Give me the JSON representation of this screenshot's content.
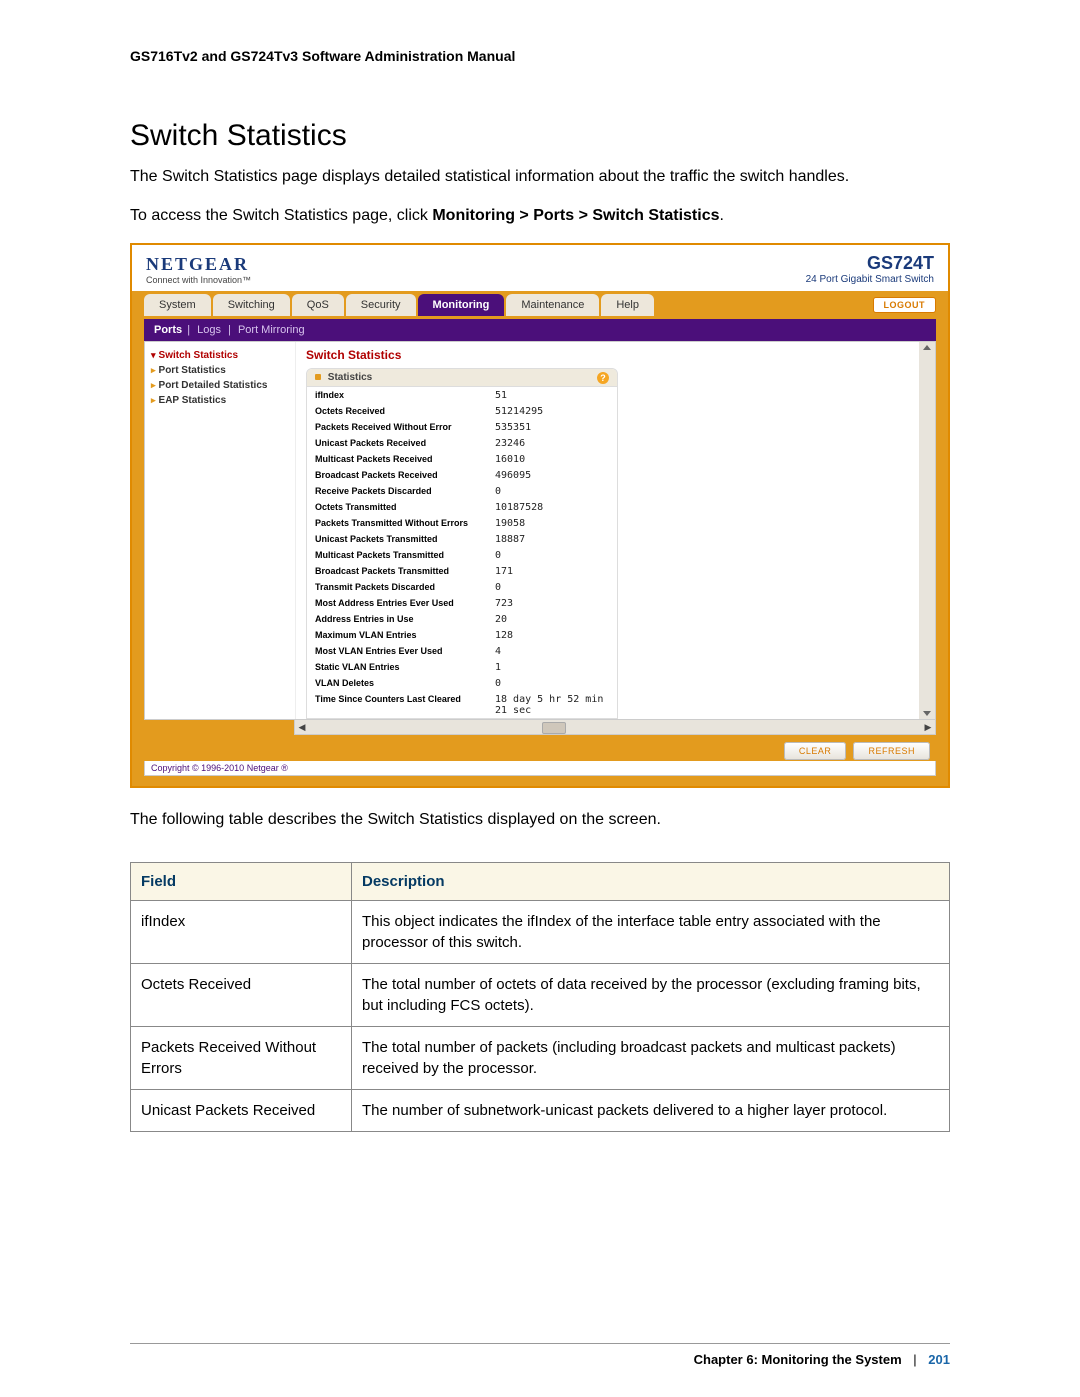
{
  "doc": {
    "running_head": "GS716Tv2 and GS724Tv3 Software Administration Manual",
    "section_title": "Switch Statistics",
    "intro1": "The Switch Statistics page displays detailed statistical information about the traffic the switch handles.",
    "intro2_pre": "To access the Switch Statistics page, click ",
    "intro2_bold": "Monitoring > Ports > Switch Statistics",
    "intro2_post": ".",
    "outro": "The following table describes the Switch Statistics displayed on the screen."
  },
  "screenshot": {
    "logo_main": "NETGEAR",
    "logo_sub": "Connect with Innovation™",
    "model_main": "GS724T",
    "model_sub": "24 Port Gigabit Smart Switch",
    "logout": "LOGOUT",
    "tabs": {
      "system": "System",
      "switching": "Switching",
      "qos": "QoS",
      "security": "Security",
      "monitoring": "Monitoring",
      "maintenance": "Maintenance",
      "help": "Help"
    },
    "subnav": {
      "ports": "Ports",
      "logs": "Logs",
      "port_mirroring": "Port Mirroring"
    },
    "sidebar": {
      "switch_statistics": "Switch Statistics",
      "port_statistics": "Port Statistics",
      "port_detailed_statistics": "Port Detailed Statistics",
      "eap_statistics": "EAP Statistics"
    },
    "content_title": "Switch Statistics",
    "box_head": "Statistics",
    "help_icon": "?",
    "stats": [
      {
        "label": "ifIndex",
        "value": "51"
      },
      {
        "label": "Octets Received",
        "value": "51214295"
      },
      {
        "label": "Packets Received Without Error",
        "value": "535351"
      },
      {
        "label": "Unicast Packets Received",
        "value": "23246"
      },
      {
        "label": "Multicast Packets Received",
        "value": "16010"
      },
      {
        "label": "Broadcast Packets Received",
        "value": "496095"
      },
      {
        "label": "Receive Packets Discarded",
        "value": "0"
      },
      {
        "label": "Octets Transmitted",
        "value": "10187528"
      },
      {
        "label": "Packets Transmitted Without Errors",
        "value": "19058"
      },
      {
        "label": "Unicast Packets Transmitted",
        "value": "18887"
      },
      {
        "label": "Multicast Packets Transmitted",
        "value": "0"
      },
      {
        "label": "Broadcast Packets Transmitted",
        "value": "171"
      },
      {
        "label": "Transmit Packets Discarded",
        "value": "0"
      },
      {
        "label": "Most Address Entries Ever Used",
        "value": "723"
      },
      {
        "label": "Address Entries in Use",
        "value": "20"
      },
      {
        "label": "Maximum VLAN Entries",
        "value": "128"
      },
      {
        "label": "Most VLAN Entries Ever Used",
        "value": "4"
      },
      {
        "label": "Static VLAN Entries",
        "value": "1"
      },
      {
        "label": "VLAN Deletes",
        "value": "0"
      },
      {
        "label": "Time Since Counters Last Cleared",
        "value": "18 day 5 hr 52 min 21 sec"
      }
    ],
    "btn_clear": "CLEAR",
    "btn_refresh": "REFRESH",
    "copyright": "Copyright © 1996-2010 Netgear ®"
  },
  "table": {
    "header_field": "Field",
    "header_desc": "Description",
    "rows": [
      {
        "field": "ifIndex",
        "desc": "This object indicates the ifIndex of the interface table entry associated with the processor of this switch."
      },
      {
        "field": "Octets Received",
        "desc": "The total number of octets of data received by the processor (excluding framing bits, but including FCS octets)."
      },
      {
        "field": "Packets Received Without Errors",
        "desc": "The total number of packets (including broadcast packets and multicast packets) received by the processor."
      },
      {
        "field": "Unicast Packets Received",
        "desc": "The number of subnetwork-unicast packets delivered to a higher layer protocol."
      }
    ]
  },
  "footer": {
    "chapter": "Chapter 6:  Monitoring the System",
    "sep": "|",
    "page": "201"
  }
}
